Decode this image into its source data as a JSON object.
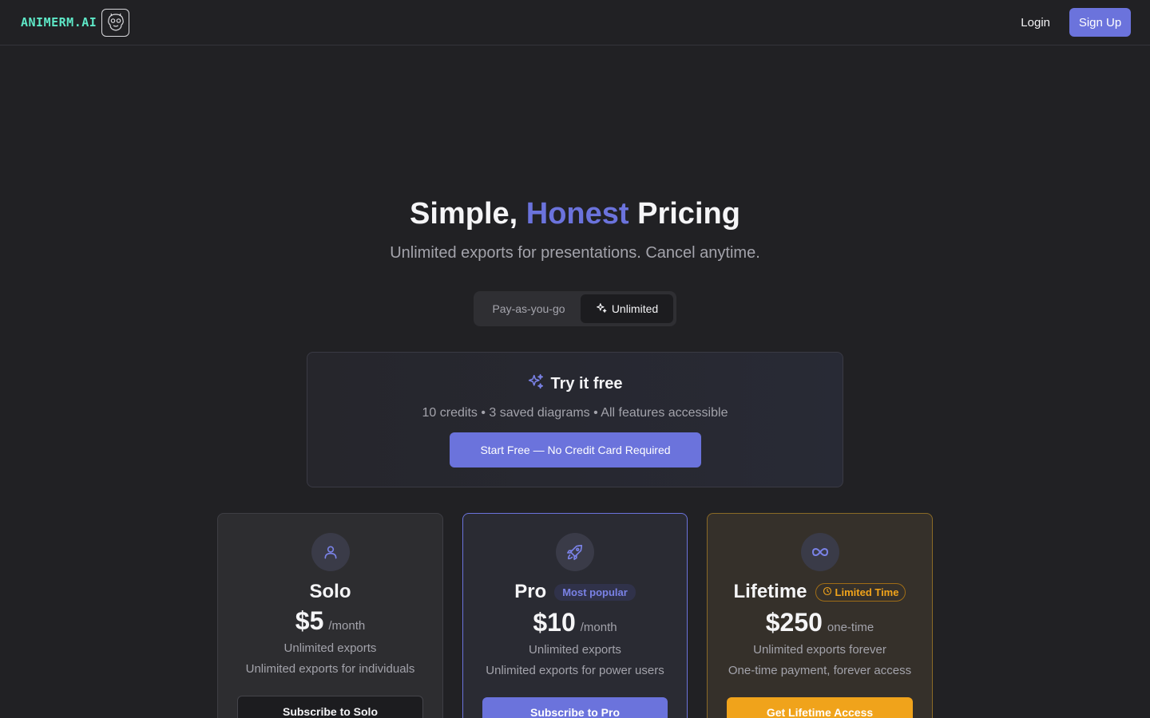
{
  "header": {
    "brand": "ANIMERM.AI",
    "login_label": "Login",
    "signup_label": "Sign Up"
  },
  "hero": {
    "title_part1": "Simple, ",
    "title_accent": "Honest",
    "title_part2": " Pricing",
    "subtitle": "Unlimited exports for presentations. Cancel anytime."
  },
  "toggle": {
    "options": [
      "Pay-as-you-go",
      "Unlimited"
    ],
    "selected": "Unlimited"
  },
  "trial": {
    "title": "Try it free",
    "subtitle": "10 credits • 3 saved diagrams • All features accessible",
    "button_label": "Start Free — No Credit Card Required"
  },
  "plans": [
    {
      "name": "Solo",
      "price": "$5",
      "period": "/month",
      "feature": "Unlimited exports",
      "description": "Unlimited exports for individuals",
      "button_label": "Subscribe to Solo",
      "icon": "user-icon"
    },
    {
      "name": "Pro",
      "badge": "Most popular",
      "price": "$10",
      "period": "/month",
      "feature": "Unlimited exports",
      "description": "Unlimited exports for power users",
      "button_label": "Subscribe to Pro",
      "icon": "rocket-icon"
    },
    {
      "name": "Lifetime",
      "badge": "Limited Time",
      "price": "$250",
      "period": "one-time",
      "feature": "Unlimited exports forever",
      "description": "One-time payment, forever access",
      "button_label": "Get Lifetime Access",
      "icon": "infinity-icon"
    }
  ],
  "colors": {
    "background": "#212124",
    "accent": "#6b73dc",
    "brand": "#5ee8c7",
    "lifetime": "#f0a31b"
  }
}
